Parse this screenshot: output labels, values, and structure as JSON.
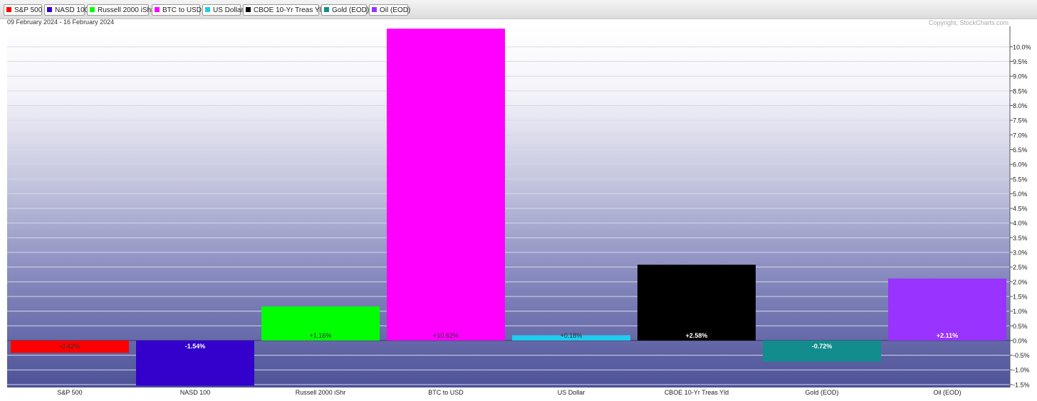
{
  "legend": [
    {
      "label": "S&P 500",
      "color": "#ff0000"
    },
    {
      "label": "NASD 100",
      "color": "#3300cc"
    },
    {
      "label": "Russell 2000 iShr",
      "color": "#00ff00"
    },
    {
      "label": "BTC to USD",
      "color": "#ff00ff"
    },
    {
      "label": "US Dollar",
      "color": "#1ecdf0"
    },
    {
      "label": "CBOE 10-Yr Treas Yld",
      "color": "#000000"
    },
    {
      "label": "Gold (EOD)",
      "color": "#128c8c"
    },
    {
      "label": "Oil (EOD)",
      "color": "#9933ff"
    }
  ],
  "date_range": "09 February 2024 - 16 February 2024",
  "copyright": "Copyright, StockCharts.com",
  "chart_data": {
    "type": "bar",
    "categories": [
      "S&P 500",
      "NASD 100",
      "Russell 2000 iShr",
      "BTC to USD",
      "US Dollar",
      "CBOE 10-Yr Treas Yld",
      "Gold (EOD)",
      "Oil (EOD)"
    ],
    "values": [
      -0.42,
      -1.54,
      1.16,
      10.62,
      0.18,
      2.58,
      -0.72,
      2.11
    ],
    "data_labels": [
      "-0.42%",
      "-1.54%",
      "+1.16%",
      "+10.62%",
      "+0.18%",
      "+2.58%",
      "-0.72%",
      "+2.11%"
    ],
    "colors": [
      "#ff0000",
      "#3300cc",
      "#00ff00",
      "#ff00ff",
      "#1ecdf0",
      "#000000",
      "#128c8c",
      "#9933ff"
    ],
    "label_colors": [
      "#333333",
      "#ffffff",
      "#333333",
      "#333333",
      "#333333",
      "#ffffff",
      "#ffffff",
      "#ffffff"
    ],
    "yticks": [
      -1.5,
      -1.0,
      -0.5,
      0.0,
      0.5,
      1.0,
      1.5,
      2.0,
      2.5,
      3.0,
      3.5,
      4.0,
      4.5,
      5.0,
      5.5,
      6.0,
      6.5,
      7.0,
      7.5,
      8.0,
      8.5,
      9.0,
      9.5,
      10.0
    ],
    "ytick_labels": [
      "-1.5%",
      "-1.0%",
      "-0.5%",
      "0.0%",
      "0.5%",
      "1.0%",
      "1.5%",
      "2.0%",
      "2.5%",
      "3.0%",
      "3.5%",
      "4.0%",
      "4.5%",
      "5.0%",
      "5.5%",
      "6.0%",
      "6.5%",
      "7.0%",
      "7.5%",
      "8.0%",
      "8.5%",
      "9.0%",
      "9.5%",
      "10.0%"
    ],
    "ylim": [
      -1.6,
      10.7
    ],
    "grid": true,
    "axis_side": "right",
    "title": "",
    "xlabel": "",
    "ylabel": ""
  }
}
